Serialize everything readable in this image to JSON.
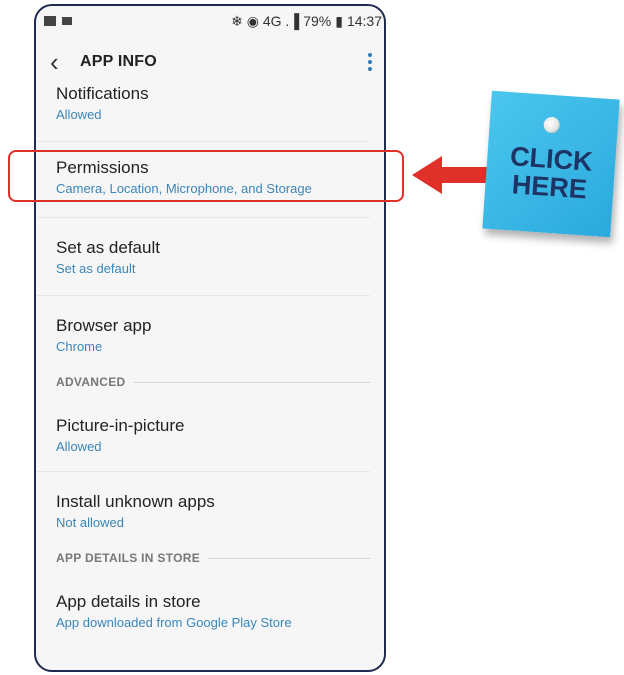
{
  "statusbar": {
    "right_icons": "❄ ◉ 4G .▐",
    "battery": "79%",
    "battery_icon": "▮",
    "time": "14:37"
  },
  "header": {
    "back_icon": "‹",
    "title": "APP INFO"
  },
  "items": [
    {
      "title": "Notifications",
      "subtitle": "Allowed"
    },
    {
      "title": "Permissions",
      "subtitle": "Camera, Location, Microphone, and Storage"
    },
    {
      "title": "Set as default",
      "subtitle": "Set as default"
    },
    {
      "title": "Browser app",
      "subtitle": "Chrome"
    },
    {
      "title": "Picture-in-picture",
      "subtitle": "Allowed"
    },
    {
      "title": "Install unknown apps",
      "subtitle": "Not allowed"
    },
    {
      "title": "App details in store",
      "subtitle": "App downloaded from Google Play Store"
    }
  ],
  "sections": {
    "advanced": "ADVANCED",
    "app_details": "APP DETAILS IN STORE"
  },
  "callout": {
    "line1": "CLICK",
    "line2": "HERE"
  },
  "colors": {
    "accent": "#3a86b8",
    "highlight": "#e0302a",
    "note": "#2aa9dd"
  }
}
